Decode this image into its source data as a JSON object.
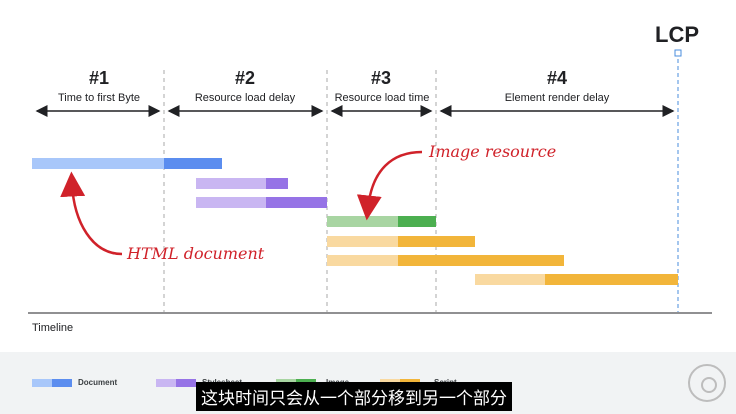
{
  "marker": {
    "label": "LCP"
  },
  "phases": [
    {
      "num": "#1",
      "label": "Time to first Byte"
    },
    {
      "num": "#2",
      "label": "Resource load delay"
    },
    {
      "num": "#3",
      "label": "Resource load time"
    },
    {
      "num": "#4",
      "label": "Element render delay"
    }
  ],
  "annotations": {
    "image_resource": "Image resource",
    "html_document": "HTML document"
  },
  "axis": {
    "label": "Timeline"
  },
  "legend": [
    {
      "label": "Document",
      "color_light": "#a8c7fa",
      "color_dark": "#5b8def"
    },
    {
      "label": "Stylesheet",
      "color_light": "#c9b6f2",
      "color_dark": "#9673e6"
    },
    {
      "label": "Image",
      "color_light": "#a8d5a2",
      "color_dark": "#4caf50"
    },
    {
      "label": "Script",
      "color_light": "#f9d9a0",
      "color_dark": "#f2b53a"
    }
  ],
  "subtitle": "这块时间只会从一个部分移到另一个部分",
  "colors": {
    "annotation": "#d0222a",
    "lcp_line": "#4a8ede",
    "divider": "#aaaaaa"
  }
}
